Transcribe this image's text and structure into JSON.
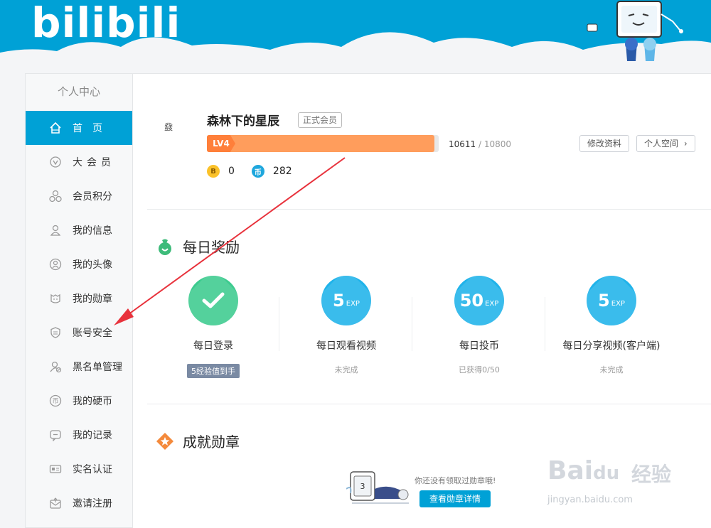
{
  "header": {
    "logo": "bilibili"
  },
  "sidebar": {
    "title": "个人中心",
    "items": [
      {
        "label": "首页",
        "icon": "home-icon",
        "active": true
      },
      {
        "label": "大会员",
        "icon": "vip-icon"
      },
      {
        "label": "会员积分",
        "icon": "points-icon"
      },
      {
        "label": "我的信息",
        "icon": "user-icon"
      },
      {
        "label": "我的头像",
        "icon": "avatar-icon"
      },
      {
        "label": "我的勋章",
        "icon": "medal-icon"
      },
      {
        "label": "账号安全",
        "icon": "shield-icon"
      },
      {
        "label": "黑名单管理",
        "icon": "blacklist-icon"
      },
      {
        "label": "我的硬币",
        "icon": "coin-icon"
      },
      {
        "label": "我的记录",
        "icon": "record-icon"
      },
      {
        "label": "实名认证",
        "icon": "id-card-icon"
      },
      {
        "label": "邀请注册",
        "icon": "invite-icon"
      }
    ]
  },
  "profile": {
    "avatar_text": "鼗",
    "username": "森林下的星辰",
    "member_tag": "正式会员",
    "level": "LV4",
    "exp_current": "10611",
    "exp_sep": "/",
    "exp_max": "10800",
    "exp_progress": 0.982,
    "edit_button": "修改资料",
    "space_button": "个人空间",
    "space_arrow": "›",
    "bcoin_glyph": "B",
    "bcoin": "0",
    "coin_glyph": "币",
    "coin": "282"
  },
  "daily": {
    "title": "每日奖励",
    "tasks": [
      {
        "name": "每日登录",
        "status": "5经验值到手",
        "done": true
      },
      {
        "name": "每日观看视频",
        "value": "5",
        "unit": "EXP",
        "status": "未完成"
      },
      {
        "name": "每日投币",
        "value": "50",
        "unit": "EXP",
        "status": "已获得0/50"
      },
      {
        "name": "每日分享视频(客户端)",
        "value": "5",
        "unit": "EXP",
        "status": "未完成"
      }
    ]
  },
  "achievement": {
    "title": "成就勋章",
    "empty_text": "你还没有领取过勋章哦!",
    "button": "查看勋章详情"
  },
  "watermark": {
    "brand": "Bai",
    "paw": "du",
    "cn": "经验",
    "url": "jingyan.baidu.com"
  },
  "colors": {
    "brand": "#00a1d6",
    "level": "#ff9d5c",
    "done": "#3dcb8f",
    "arrow": "#e8323c"
  }
}
